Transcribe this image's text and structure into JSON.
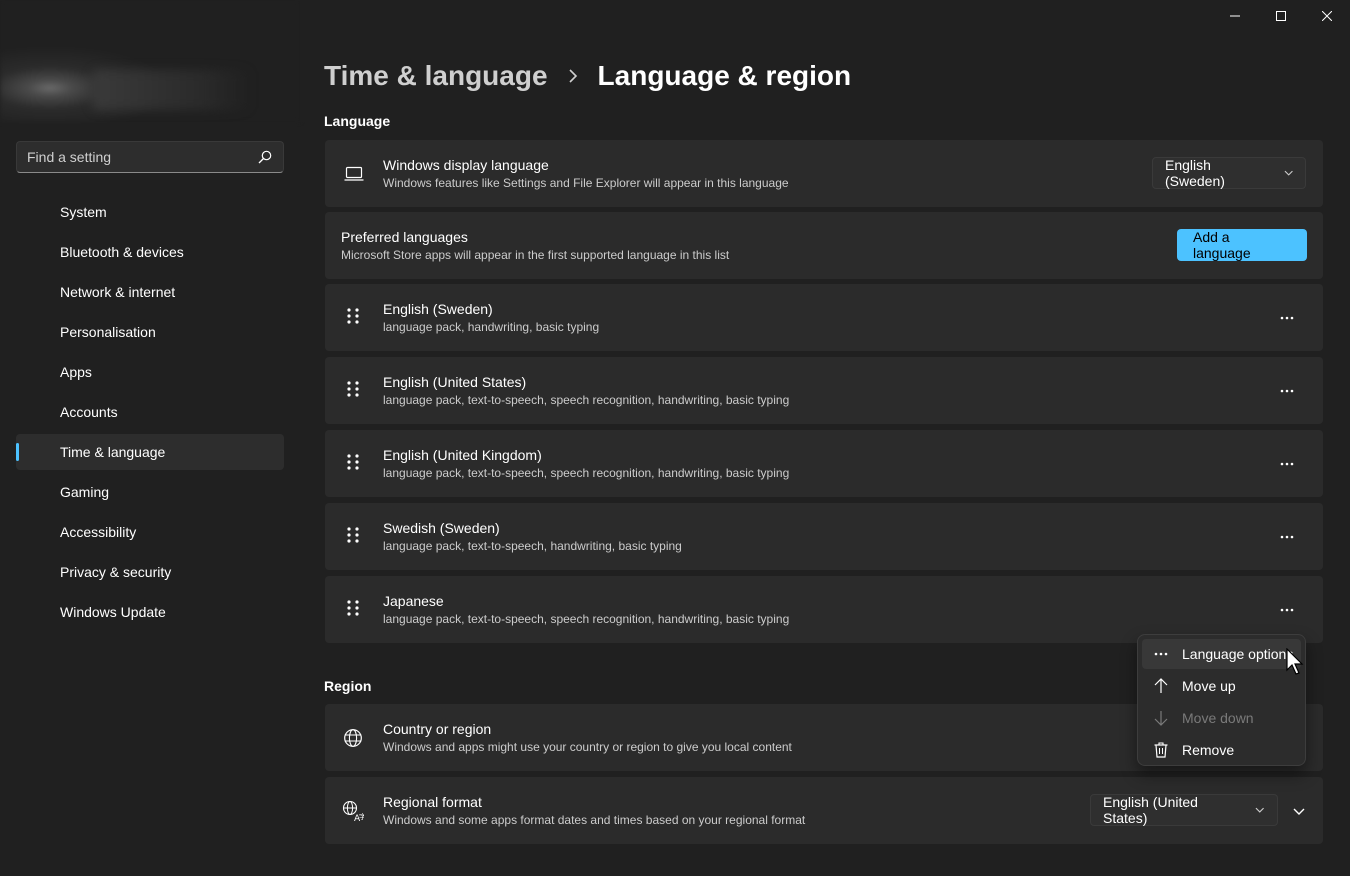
{
  "window": {
    "controls": {
      "minimize_icon": "minimize-icon",
      "maximize_icon": "maximize-icon",
      "close_icon": "close-icon"
    }
  },
  "sidebar": {
    "search": {
      "placeholder": "Find a setting",
      "icon": "search-icon"
    },
    "items": [
      {
        "label": "System"
      },
      {
        "label": "Bluetooth & devices"
      },
      {
        "label": "Network & internet"
      },
      {
        "label": "Personalisation"
      },
      {
        "label": "Apps"
      },
      {
        "label": "Accounts"
      },
      {
        "label": "Time & language",
        "selected": true
      },
      {
        "label": "Gaming"
      },
      {
        "label": "Accessibility"
      },
      {
        "label": "Privacy & security"
      },
      {
        "label": "Windows Update"
      }
    ]
  },
  "breadcrumb": {
    "parent": "Time & language",
    "current": "Language & region"
  },
  "language_section": {
    "title": "Language",
    "display_language": {
      "title": "Windows display language",
      "subtitle": "Windows features like Settings and File Explorer will appear in this language",
      "value": "English (Sweden)",
      "icon": "laptop-icon"
    },
    "preferred": {
      "title": "Preferred languages",
      "subtitle": "Microsoft Store apps will appear in the first supported language in this list",
      "button": "Add a language"
    },
    "languages": [
      {
        "name": "English (Sweden)",
        "features": "language pack, handwriting, basic typing"
      },
      {
        "name": "English (United States)",
        "features": "language pack, text-to-speech, speech recognition, handwriting, basic typing"
      },
      {
        "name": "English (United Kingdom)",
        "features": "language pack, text-to-speech, speech recognition, handwriting, basic typing"
      },
      {
        "name": "Swedish (Sweden)",
        "features": "language pack, text-to-speech, handwriting, basic typing"
      },
      {
        "name": "Japanese",
        "features": "language pack, text-to-speech, speech recognition, handwriting, basic typing"
      }
    ]
  },
  "region_section": {
    "title": "Region",
    "country": {
      "title": "Country or region",
      "subtitle": "Windows and apps might use your country or region to give you local content",
      "icon": "globe-icon"
    },
    "format": {
      "title": "Regional format",
      "subtitle": "Windows and some apps format dates and times based on your regional format",
      "value": "English (United States)",
      "icon": "regional-format-icon"
    }
  },
  "context_menu": {
    "items": [
      {
        "label": "Language options",
        "icon": "more-icon"
      },
      {
        "label": "Move up",
        "icon": "arrow-up-icon"
      },
      {
        "label": "Move down",
        "icon": "arrow-down-icon",
        "disabled": true
      },
      {
        "label": "Remove",
        "icon": "trash-icon"
      }
    ]
  },
  "colors": {
    "accent": "#4cc2ff",
    "background": "#202020",
    "card": "#2b2b2b"
  }
}
